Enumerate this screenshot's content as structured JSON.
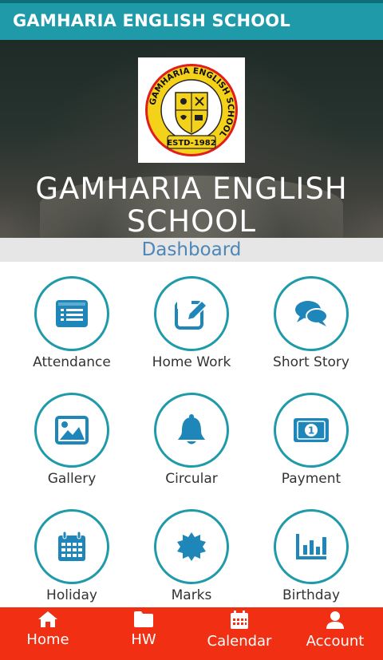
{
  "app_bar": {
    "title": "GAMHARIA ENGLISH SCHOOL"
  },
  "hero": {
    "school_name_line1": "GAMHARIA ENGLISH",
    "school_name_line2": "SCHOOL",
    "logo": {
      "ring_text": "GAMHARIA ENGLISH SCHOOL",
      "estd": "ESTD-1982"
    }
  },
  "dashboard": {
    "label": "Dashboard"
  },
  "tiles": [
    {
      "label": "Attendance",
      "icon": "list-icon"
    },
    {
      "label": "Home Work",
      "icon": "edit-icon"
    },
    {
      "label": "Short Story",
      "icon": "comments-icon"
    },
    {
      "label": "Gallery",
      "icon": "image-icon"
    },
    {
      "label": "Circular",
      "icon": "bell-icon"
    },
    {
      "label": "Payment",
      "icon": "money-icon"
    },
    {
      "label": "Holiday",
      "icon": "calendar-icon"
    },
    {
      "label": "Marks",
      "icon": "certificate-icon"
    },
    {
      "label": "Birthday",
      "icon": "bar-chart-icon"
    }
  ],
  "bottom_nav": [
    {
      "label": "Home",
      "icon": "home-icon"
    },
    {
      "label": "HW",
      "icon": "folder-icon"
    },
    {
      "label": "Calendar",
      "icon": "calendar-icon"
    },
    {
      "label": "Account",
      "icon": "user-icon"
    }
  ],
  "colors": {
    "primary": "#1e9aa8",
    "icon_blue": "#1e86b8",
    "bottom_nav": "#f02f13",
    "dashboard_text": "#4d87b8"
  }
}
